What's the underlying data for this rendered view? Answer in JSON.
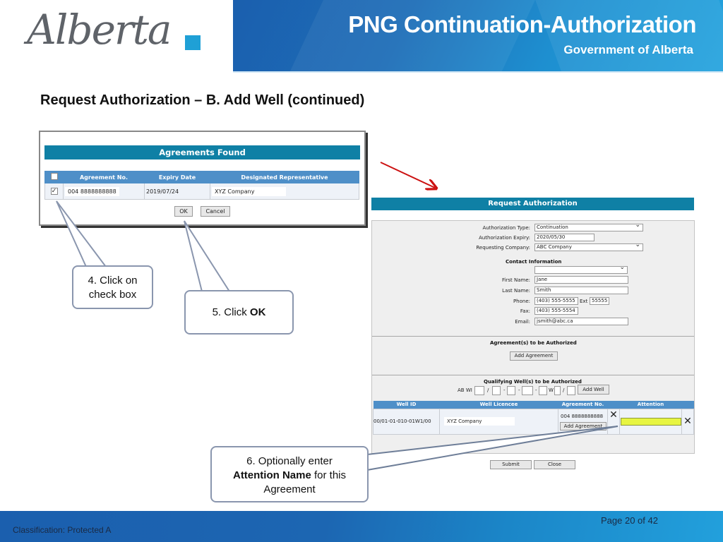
{
  "header": {
    "logo_text": "Alberta",
    "title": "PNG Continuation-Authorization",
    "subtitle": "Government of Alberta"
  },
  "slide_title": "Request Authorization – B. Add Well (continued)",
  "agreements_dialog": {
    "title": "Agreements Found",
    "columns": [
      "",
      "Agreement No.",
      "Expiry Date",
      "Designated Representative"
    ],
    "rows": [
      {
        "checked": true,
        "agreement_no": "004 8888888888",
        "expiry_date": "2019/07/24",
        "representative": "XYZ Company"
      }
    ],
    "ok_label": "OK",
    "cancel_label": "Cancel"
  },
  "request_form": {
    "title": "Request Authorization",
    "authorization_type": {
      "label": "Authorization Type:",
      "value": "Continuation"
    },
    "authorization_expiry": {
      "label": "Authorization Expiry:",
      "value": "2020/05/30"
    },
    "requesting_company": {
      "label": "Requesting Company:",
      "value": "ABC Company"
    },
    "contact_heading": "Contact Information",
    "contact_select": "",
    "first_name": {
      "label": "First Name:",
      "value": "Jane"
    },
    "last_name": {
      "label": "Last Name:",
      "value": "Smith"
    },
    "phone": {
      "label": "Phone:",
      "value": "(403) 555-5555",
      "ext_label": "Ext",
      "ext_value": "55555"
    },
    "fax": {
      "label": "Fax:",
      "value": "(403) 555-5554"
    },
    "email": {
      "label": "Email:",
      "value": "jsmith@abc.ca"
    },
    "agreements_heading": "Agreement(s) to be Authorized",
    "add_agreement_label": "Add Agreement",
    "wells_heading": "Qualifying Well(s) to be Authorized",
    "well_prefix": "AB WI",
    "well_separators": [
      "/",
      "-",
      "-",
      "-",
      "W",
      "/"
    ],
    "add_well_label": "Add Well",
    "well_columns": [
      "Well ID",
      "Well Licencee",
      "Agreement No.",
      "",
      "Attention",
      ""
    ],
    "well_rows": [
      {
        "well_id": "00/01-01-010-01W1/00",
        "licencee": "XYZ Company",
        "agreement_no": "004 8888888888",
        "add_agreement_label": "Add Agreement",
        "attention": ""
      }
    ],
    "submit_label": "Submit",
    "close_label": "Close"
  },
  "callouts": {
    "step4": "4. Click on check box",
    "step4_line1": "4. Click on",
    "step4_line2": "check box",
    "step5_prefix": "5. Click ",
    "step5_bold": "OK",
    "step6_line1": "6. Optionally enter",
    "step6_bold": "Attention Name",
    "step6_rest": " for this",
    "step6_line3": "Agreement"
  },
  "footer": {
    "classification": "Classification: Protected A",
    "page": "Page 20 of 42"
  },
  "colors": {
    "banner_blue": "#1c6db7",
    "table_header_blue": "#4e8fc8",
    "title_bar_teal": "#0f80a5",
    "attention_highlight": "#e7f542",
    "arrow_red": "#cc1111",
    "callout_border": "#8a96ae"
  }
}
